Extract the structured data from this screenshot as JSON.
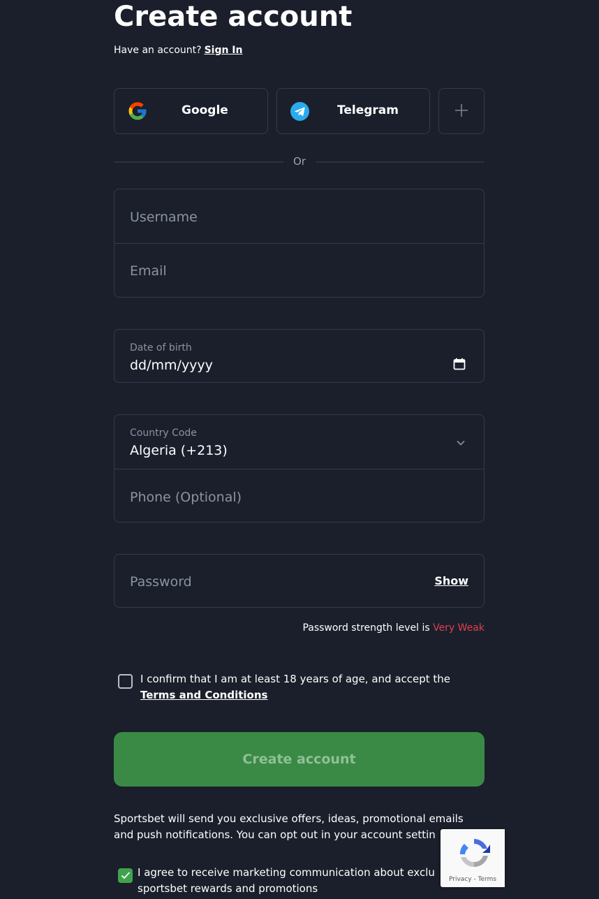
{
  "header": {
    "title": "Create account",
    "have_account_text": "Have an account?",
    "sign_in_link": "Sign In"
  },
  "social": {
    "google_label": "Google",
    "telegram_label": "Telegram",
    "more_icon": "plus-icon"
  },
  "divider": {
    "or_text": "Or"
  },
  "form": {
    "username_placeholder": "Username",
    "email_placeholder": "Email",
    "dob_label": "Date of birth",
    "dob_value": "dd/mm/yyyy",
    "country_label": "Country Code",
    "country_value": "Algeria (+213)",
    "phone_placeholder": "Phone (Optional)",
    "password_placeholder": "Password",
    "show_label": "Show",
    "strength_prefix": "Password strength level is",
    "strength_value": "Very Weak"
  },
  "terms": {
    "confirm_text": "I confirm that I am at least 18 years of age, and accept the",
    "terms_link": "Terms and Conditions",
    "checked": false
  },
  "actions": {
    "create_button": "Create account"
  },
  "marketing": {
    "offers_text": "Sportsbet will send you exclusive offers, ideas, promotional emails and push notifications. You can opt out in your account settin",
    "agree_text": "I agree to receive marketing communication about exclu sportsbet rewards and promotions",
    "agree_checked": true
  },
  "recaptcha": {
    "links": "Privacy - Terms"
  },
  "colors": {
    "background": "#1a1f2b",
    "border": "#343b4a",
    "accent_green": "#3a8a46",
    "weak_red": "#e23f4f"
  }
}
